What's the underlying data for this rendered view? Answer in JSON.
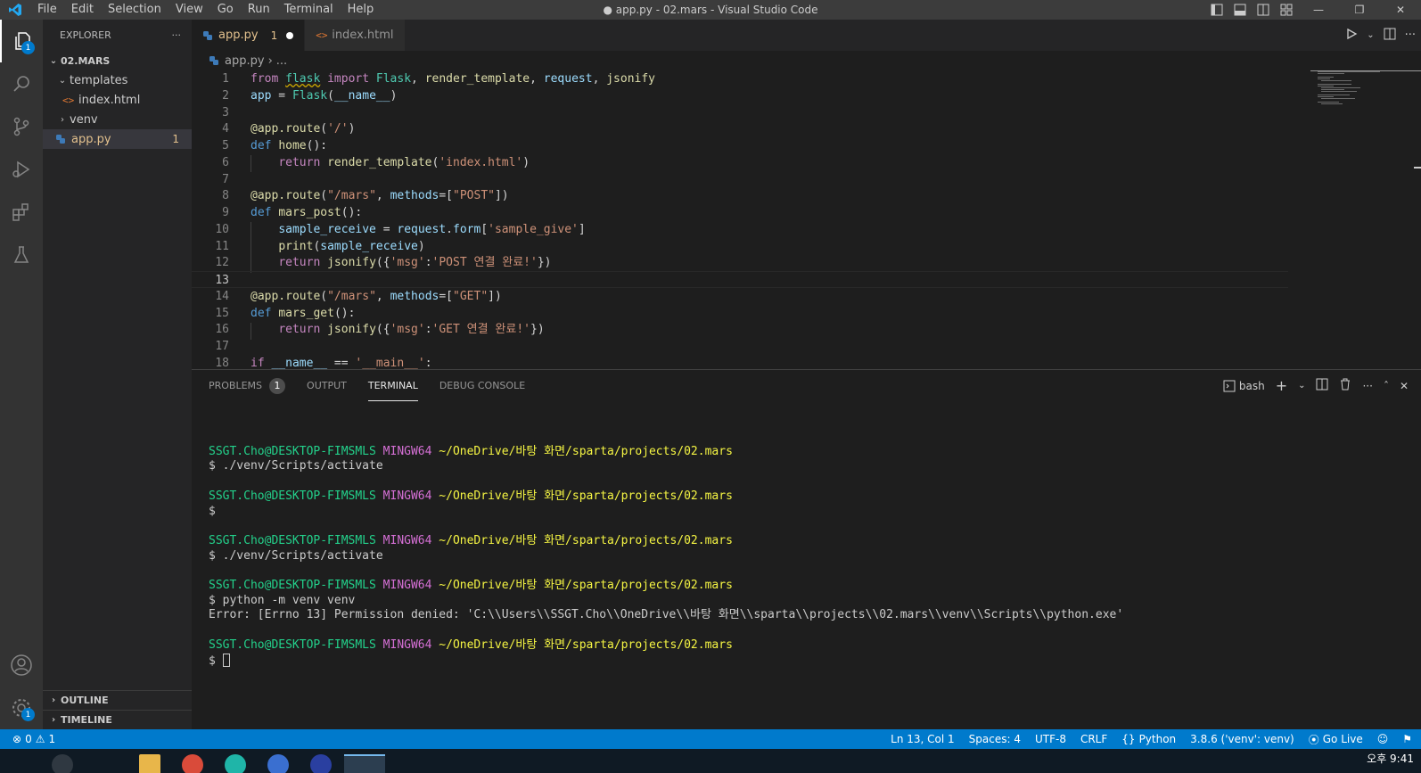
{
  "window": {
    "title": "● app.py - 02.mars - Visual Studio Code",
    "menu": [
      "File",
      "Edit",
      "Selection",
      "View",
      "Go",
      "Run",
      "Terminal",
      "Help"
    ]
  },
  "activity": {
    "explorer_badge": "1",
    "settings_badge": "1"
  },
  "sidebar": {
    "header": "EXPLORER",
    "more": "···",
    "root": "02.MARS",
    "items": [
      {
        "label": "templates"
      },
      {
        "label": "index.html"
      },
      {
        "label": "venv"
      },
      {
        "label": "app.py",
        "badge": "1"
      }
    ],
    "outline": "OUTLINE",
    "timeline": "TIMELINE"
  },
  "tabs": [
    {
      "label": "app.py",
      "problems": "1"
    },
    {
      "label": "index.html"
    }
  ],
  "breadcrumb": {
    "file": "app.py",
    "rest": "..."
  },
  "editor": {
    "current_line": 13,
    "lines": [
      {
        "n": "1"
      },
      {
        "n": "2"
      },
      {
        "n": "3"
      },
      {
        "n": "4"
      },
      {
        "n": "5"
      },
      {
        "n": "6"
      },
      {
        "n": "7"
      },
      {
        "n": "8"
      },
      {
        "n": "9"
      },
      {
        "n": "10"
      },
      {
        "n": "11"
      },
      {
        "n": "12"
      },
      {
        "n": "13"
      },
      {
        "n": "14"
      },
      {
        "n": "15"
      },
      {
        "n": "16"
      },
      {
        "n": "17"
      },
      {
        "n": "18"
      }
    ]
  },
  "panel": {
    "tabs": [
      {
        "label": "PROBLEMS",
        "badge": "1"
      },
      {
        "label": "OUTPUT"
      },
      {
        "label": "TERMINAL"
      },
      {
        "label": "DEBUG CONSOLE"
      }
    ],
    "shell": "bash",
    "terminal": {
      "user": "SSGT.Cho@DESKTOP-FIMSMLS",
      "host": "MINGW64",
      "path": "~/OneDrive/바탕 화면/sparta/projects/02.mars",
      "cmd1": "$ ./venv/Scripts/activate",
      "cmd2": "$",
      "cmd3": "$ ./venv/Scripts/activate",
      "cmd4": "$ python -m venv venv",
      "error": "Error: [Errno 13] Permission denied: 'C:\\\\Users\\\\SSGT.Cho\\\\OneDrive\\\\바탕 화면\\\\sparta\\\\projects\\\\02.mars\\\\venv\\\\Scripts\\\\python.exe'",
      "prompt": "$"
    }
  },
  "statusbar": {
    "errors": "0",
    "warnings": "1",
    "position": "Ln 13, Col 1",
    "spaces": "Spaces: 4",
    "encoding": "UTF-8",
    "eol": "CRLF",
    "language": "Python",
    "interpreter": "3.8.6 ('venv': venv)",
    "golive": "Go Live"
  },
  "taskbar": {
    "clock": "오후 9:41"
  },
  "colors": {
    "accent": "#007acc",
    "modified": "#e2c08d",
    "term_user": "#23d18b",
    "term_host": "#d670d6",
    "term_path": "#f5f543"
  }
}
